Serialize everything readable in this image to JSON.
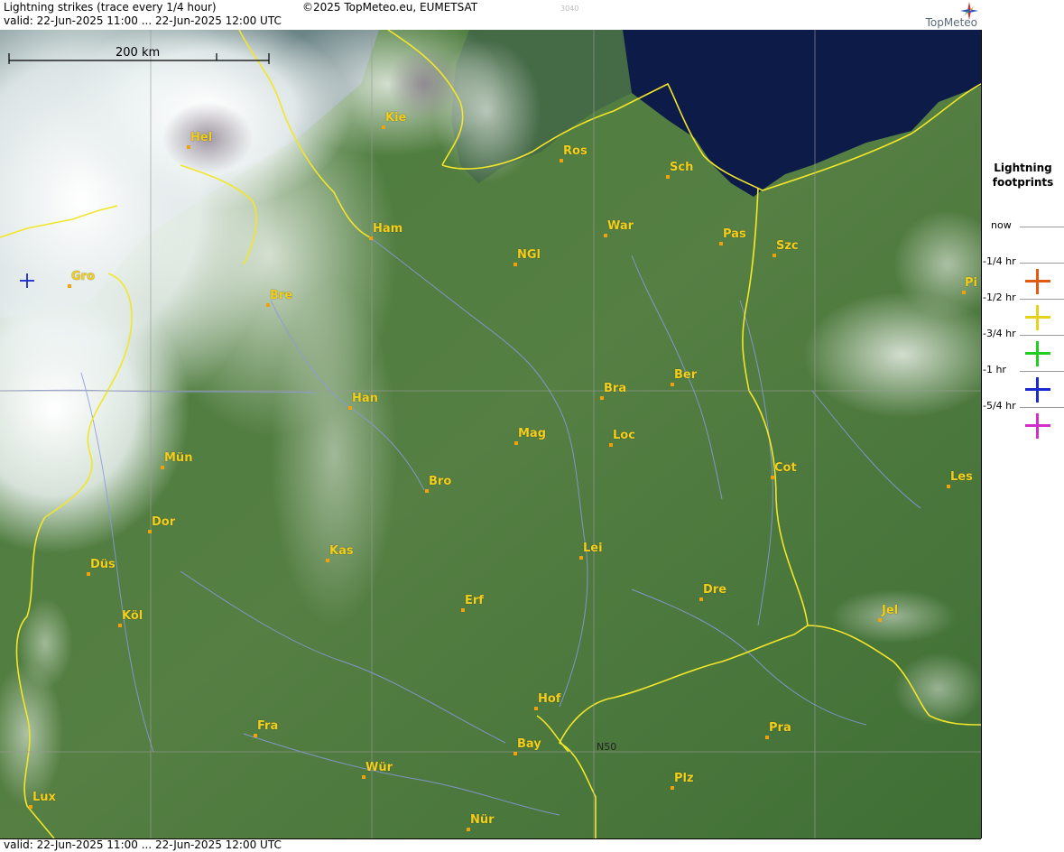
{
  "header": {
    "title": "Lightning strikes (trace every 1/4 hour)",
    "valid": "valid:  22-Jun-2025 11:00 ... 22-Jun-2025 12:00 UTC",
    "copyright": "©2025 TopMeteo.eu, EUMETSAT",
    "code": "3040",
    "logo_text": "TopMeteo"
  },
  "footer": {
    "valid": "valid:  22-Jun-2025 11:00 ... 22-Jun-2025 12:00 UTC"
  },
  "legend": {
    "title": "Lightning footprints",
    "entries": [
      {
        "label": "now"
      },
      {
        "label": "-1/4 hr",
        "color": "#e05a10"
      },
      {
        "label": "-1/2 hr",
        "color": "#e6d21a"
      },
      {
        "label": "-3/4 hr",
        "color": "#22cc22"
      },
      {
        "label": "-1 hr",
        "color": "#1a2acc"
      },
      {
        "label": "-5/4 hr",
        "color": "#d030c8"
      }
    ]
  },
  "map": {
    "scale_label": "200 km",
    "grid_label": "N50",
    "strike_color": "#1a2acc",
    "cities": [
      {
        "name": "Kie"
      },
      {
        "name": "Hel"
      },
      {
        "name": "Ros"
      },
      {
        "name": "Sch"
      },
      {
        "name": "Ham"
      },
      {
        "name": "War"
      },
      {
        "name": "Pas"
      },
      {
        "name": "Szc"
      },
      {
        "name": "NGl"
      },
      {
        "name": "Gro"
      },
      {
        "name": "Bre"
      },
      {
        "name": "Pi"
      },
      {
        "name": "Ber"
      },
      {
        "name": "Bra"
      },
      {
        "name": "Han"
      },
      {
        "name": "Mag"
      },
      {
        "name": "Loc"
      },
      {
        "name": "Mün"
      },
      {
        "name": "Cot"
      },
      {
        "name": "Les"
      },
      {
        "name": "Bro"
      },
      {
        "name": "Dor"
      },
      {
        "name": "Lei"
      },
      {
        "name": "Kas"
      },
      {
        "name": "Düs"
      },
      {
        "name": "Erf"
      },
      {
        "name": "Dre"
      },
      {
        "name": "Jel"
      },
      {
        "name": "Köl"
      },
      {
        "name": "Hof"
      },
      {
        "name": "Fra"
      },
      {
        "name": "Pra"
      },
      {
        "name": "Bay"
      },
      {
        "name": "Wür"
      },
      {
        "name": "Plz"
      },
      {
        "name": "Lux"
      },
      {
        "name": "Nür"
      }
    ]
  }
}
